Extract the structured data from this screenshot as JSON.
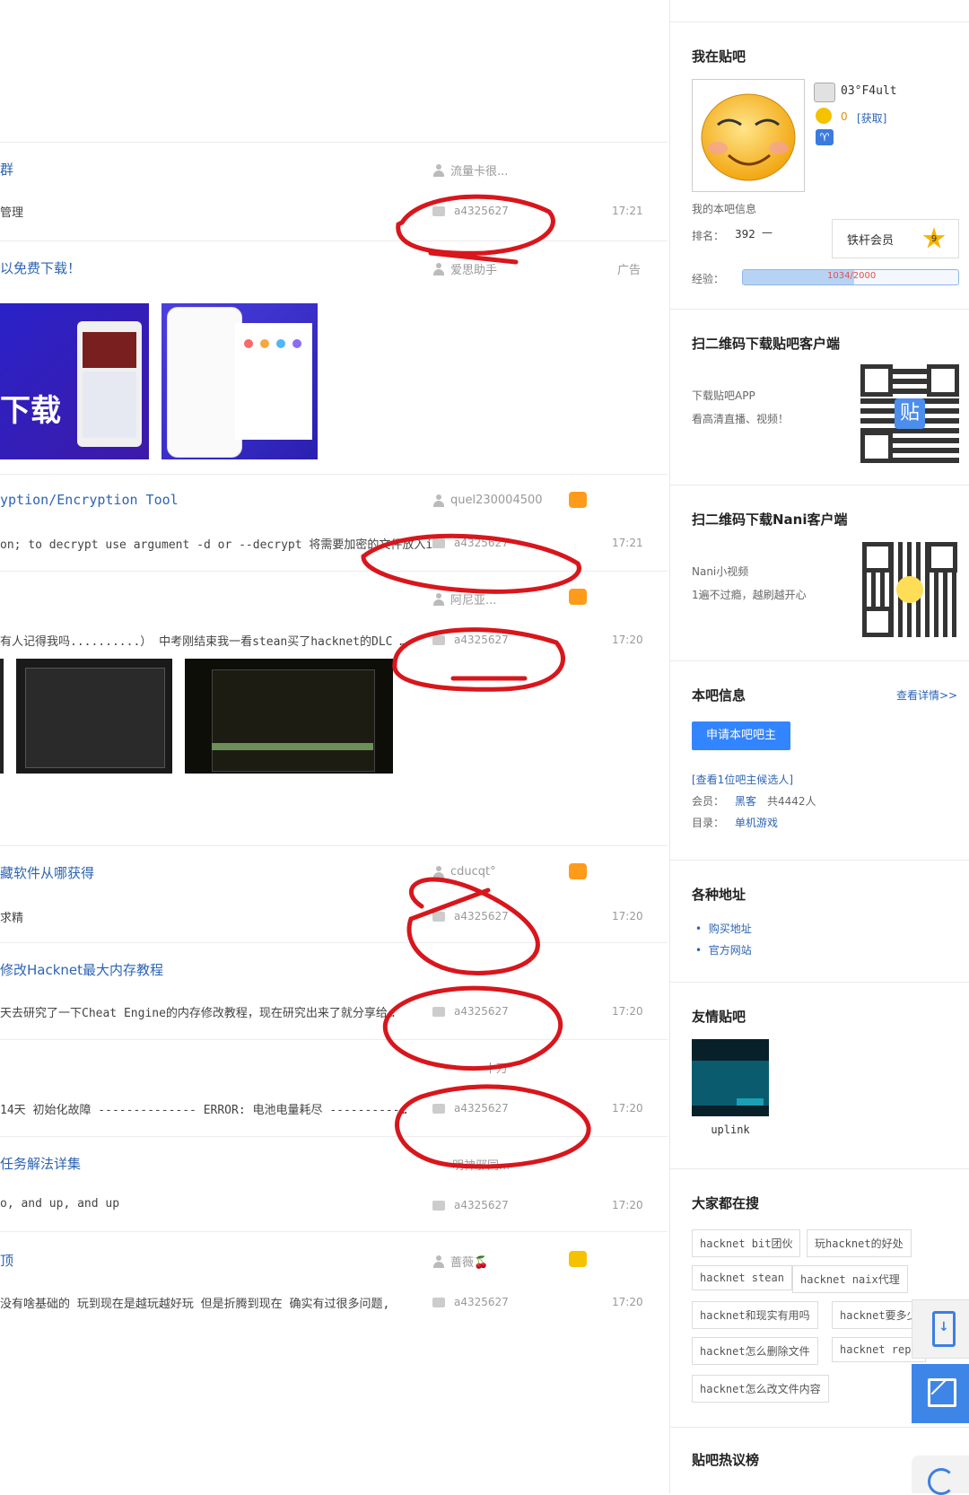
{
  "threads": [
    {
      "title": "群",
      "abstract": "管理",
      "author": "流量卡很...",
      "reply_user": "a4325627",
      "time": "17:21"
    },
    {
      "title": "以免费下载！",
      "author": "爱思助手",
      "tag": "广告"
    },
    {
      "title": "yption/Encryption Tool",
      "abstract": "on; to decrypt use argument -d or --decrypt 将需要加密的文件放入i…",
      "author": "quel230004500",
      "reply_user": "a4325627",
      "time": "17:21"
    },
    {
      "title": "",
      "abstract": "有人记得我吗..........）  中考刚结束我一看stean买了hacknet的DLC …",
      "author": "阿尼亚...",
      "reply_user": "a4325627",
      "time": "17:20"
    },
    {
      "title": "藏软件从哪获得",
      "abstract": "求精",
      "author": "cducqt°",
      "reply_user": "a4325627",
      "time": "17:20"
    },
    {
      "title": "修改Hacknet最大内存教程",
      "abstract": "天去研究了一下Cheat Engine的内存修改教程，现在研究出来了就分享给…",
      "author": "",
      "reply_user": "a4325627",
      "time": "17:20"
    },
    {
      "title": "",
      "abstract": "14天  初始化故障 -------------- ERROR: 电池电量耗尽 ----------…",
      "author": "十万",
      "reply_user": "a4325627",
      "time": "17:20"
    },
    {
      "title": "任务解法详集",
      "abstract": "o, and up, and up",
      "author": "明神邪同...",
      "reply_user": "a4325627",
      "time": "17:20"
    },
    {
      "title": "顶",
      "abstract": "没有啥基础的 玩到现在是越玩越好玩 但是折腾到现在 确实有过很多问题,",
      "author": "蔷薇🍒",
      "reply_user": "a4325627",
      "time": "17:20"
    }
  ],
  "ad_banner": {
    "text": "下载"
  },
  "sidebar": {
    "my_bar": {
      "title": "我在贴吧",
      "username": "03°F4ult",
      "coins": "0",
      "coins_action": "[获取]",
      "info_label": "我的本吧信息",
      "rank_label": "排名：",
      "rank_value": "392",
      "rank_trend": "—",
      "member_label": "铁杆会员",
      "member_level": "9",
      "exp_label": "经验：",
      "exp_value": "1034/2000",
      "exp_fraction": 0.517
    },
    "app_qr": {
      "title": "扫二维码下载贴吧客户端",
      "line1": "下载贴吧APP",
      "line2": "看高清直播、视频！"
    },
    "nani_qr": {
      "title": "扫二维码下载Nani客户端",
      "line1": "Nani小视频",
      "line2": "1遍不过瘾，越刷越开心"
    },
    "bar_info": {
      "title": "本吧信息",
      "more": "查看详情>>",
      "apply_button": "申请本吧吧主",
      "candidates": "[查看1位吧主候选人]",
      "members_label": "会员：",
      "members_name": "黑客",
      "members_count": "共4442人",
      "dir_label": "目录：",
      "dir_value": "单机游戏"
    },
    "addresses": {
      "title": "各种地址",
      "items": [
        "购买地址",
        "官方网站"
      ]
    },
    "friend_bars": {
      "title": "友情贴吧",
      "name": "uplink"
    },
    "searching": {
      "title": "大家都在搜",
      "tags": [
        "hacknet bit团伙",
        "玩hacknet的好处",
        "hacknet stean",
        "hacknet naix代理",
        "hacknet和现实有用吗",
        "hacknet要多少",
        "hacknet怎么删除文件",
        "hacknet repl",
        "hacknet怎么改文件内容"
      ]
    },
    "hot_list": {
      "title": "贴吧热议榜"
    }
  },
  "colors": {
    "link": "#2d64b3",
    "annotation": "#d8161c",
    "primary_button": "#3385ff"
  }
}
